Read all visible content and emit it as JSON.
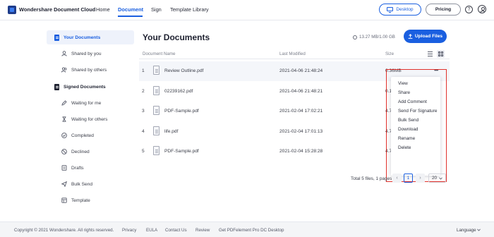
{
  "brand": {
    "name": "Wondershare Document Cloud"
  },
  "nav": {
    "home": "Home",
    "document": "Document",
    "sign": "Sign",
    "template_library": "Template Library"
  },
  "header_actions": {
    "desktop": "Desktop",
    "pricing": "Pricing",
    "help": "?"
  },
  "sidebar": {
    "your_documents": "Your Documents",
    "shared_by_you": "Shared by you",
    "shared_by_others": "Shared by others",
    "signed_documents": "Signed Documents",
    "waiting_for_me": "Waiting for me",
    "waiting_for_others": "Waiting for others",
    "completed": "Completed",
    "declined": "Declined",
    "drafts": "Drafts",
    "bulk_send": "Bulk Send",
    "template": "Template"
  },
  "main": {
    "title": "Your Documents",
    "storage": "13.27 MB/1.00 GB",
    "upload": "Upload Files",
    "columns": {
      "name": "Document Name",
      "modified": "Last Modified",
      "size": "Size"
    }
  },
  "files": [
    {
      "num": "1",
      "name": "Review Outline.pdf",
      "modified": "2021-04-06 21:48:24",
      "size": "0.36MB"
    },
    {
      "num": "2",
      "name": "02239162.pdf",
      "modified": "2021-04-06 21:48:21",
      "size": "0.10"
    },
    {
      "num": "3",
      "name": "PDF-Sample.pdf",
      "modified": "2021-02-04 17:02:21",
      "size": "4.73"
    },
    {
      "num": "4",
      "name": "life.pdf",
      "modified": "2021-02-04 17:01:13",
      "size": "4.73"
    },
    {
      "num": "5",
      "name": "PDF-Sample.pdf",
      "modified": "2021-02-04 15:28:28",
      "size": "4.73"
    }
  ],
  "context_menu": {
    "view": "View",
    "share": "Share",
    "add_comment": "Add Comment",
    "send_for_signature": "Send For Signature",
    "bulk_send": "Bulk Send",
    "download": "Download",
    "rename": "Rename",
    "delete": "Delete"
  },
  "pagination": {
    "summary": "Total 5 files, 1 pages",
    "current": "1",
    "page_size": "20"
  },
  "footer": {
    "copyright": "Copyright © 2021 Wondershare. All rights reserved.",
    "privacy": "Privacy",
    "eula": "EULA",
    "contact": "Contact Us",
    "review": "Review",
    "get_pdfelement": "Get PDFelement Pro DC Desktop",
    "language": "Language"
  },
  "colors": {
    "accent": "#1a5fe0",
    "highlight_box": "#e0312c",
    "text": "#1e2130"
  }
}
